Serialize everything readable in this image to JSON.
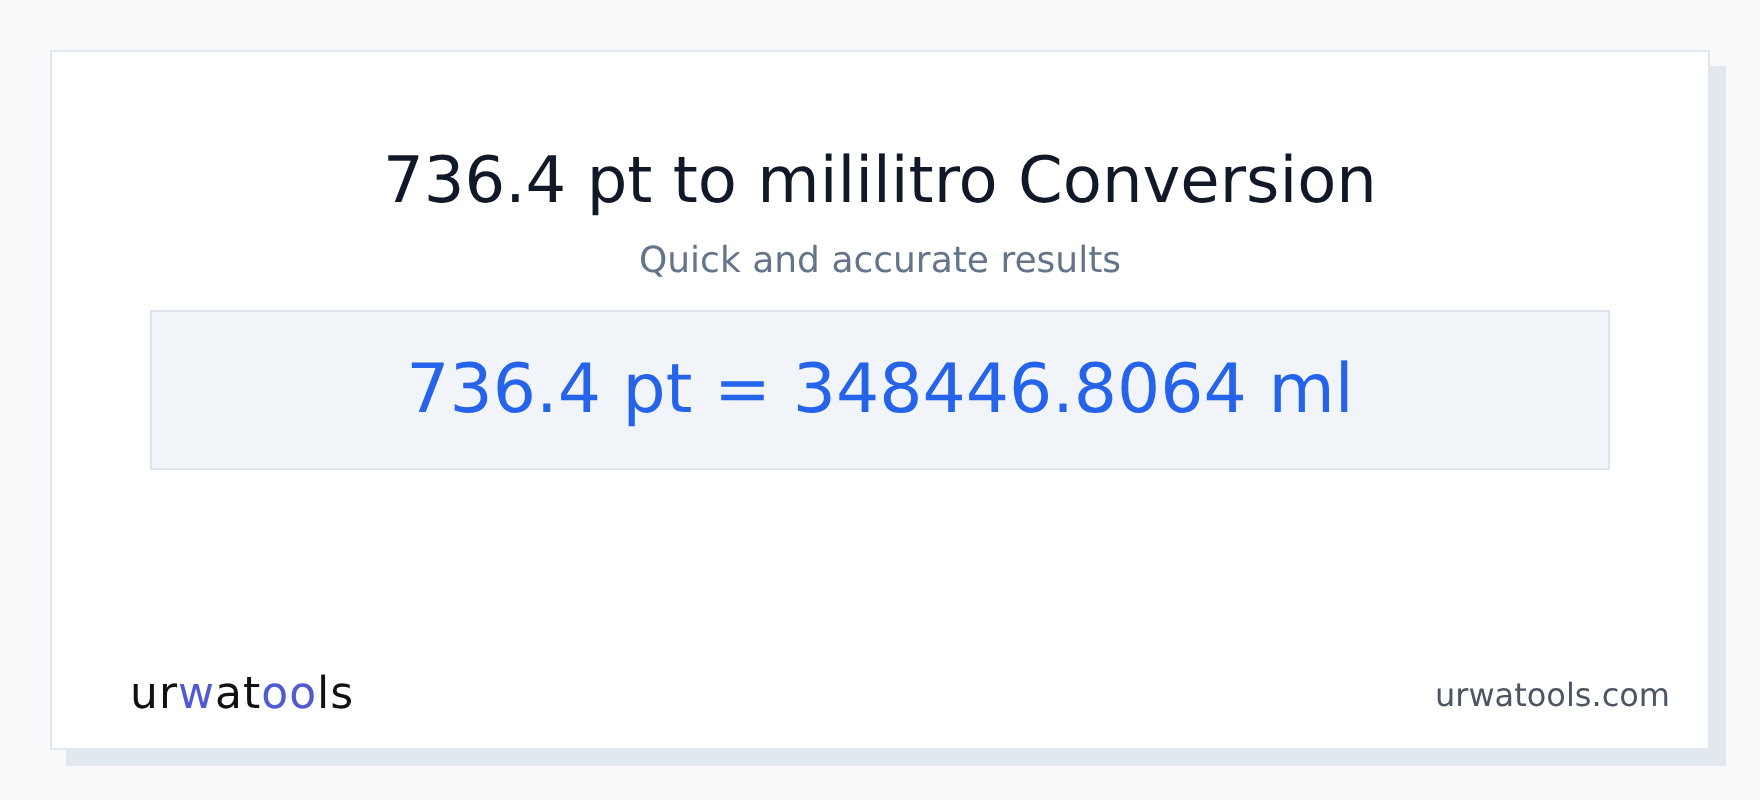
{
  "title": "736.4 pt to mililitro Conversion",
  "subtitle": "Quick and accurate results",
  "result": "736.4 pt = 348446.8064 ml",
  "logo": [
    {
      "text": "ur",
      "accent": false
    },
    {
      "text": "w",
      "accent": true
    },
    {
      "text": "at",
      "accent": false
    },
    {
      "text": "oo",
      "accent": true
    },
    {
      "text": "ls",
      "accent": false
    }
  ],
  "site": "urwatools.com"
}
